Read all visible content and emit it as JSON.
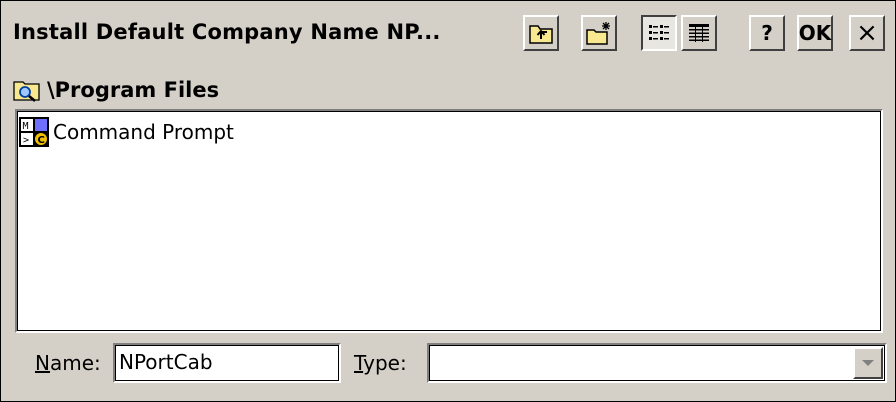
{
  "window": {
    "title": "Install Default Company Name NP...",
    "toolbar": [
      {
        "name": "up-folder-icon"
      },
      {
        "name": "new-folder-icon"
      },
      {
        "name": "list-view-icon",
        "pressed": true
      },
      {
        "name": "details-view-icon"
      },
      {
        "name": "help-button",
        "label": "?"
      },
      {
        "name": "ok-button",
        "label": "OK"
      },
      {
        "name": "close-button",
        "label": "×"
      }
    ]
  },
  "path": {
    "icon": "folder-search-icon",
    "label": "\\Program Files"
  },
  "file_list": {
    "items": [
      {
        "label": "Command Prompt",
        "icon": "command-prompt-icon"
      }
    ]
  },
  "footer": {
    "name_label_hotkey": "N",
    "name_label_rest": "ame:",
    "name_value": "NPortCab",
    "type_label_hotkey": "T",
    "type_label_rest": "ype:",
    "type_value": ""
  },
  "colors": {
    "face": "#d4d0c8",
    "highlight": "#ffffff",
    "shadow": "#808080",
    "dark_shadow": "#404040"
  }
}
